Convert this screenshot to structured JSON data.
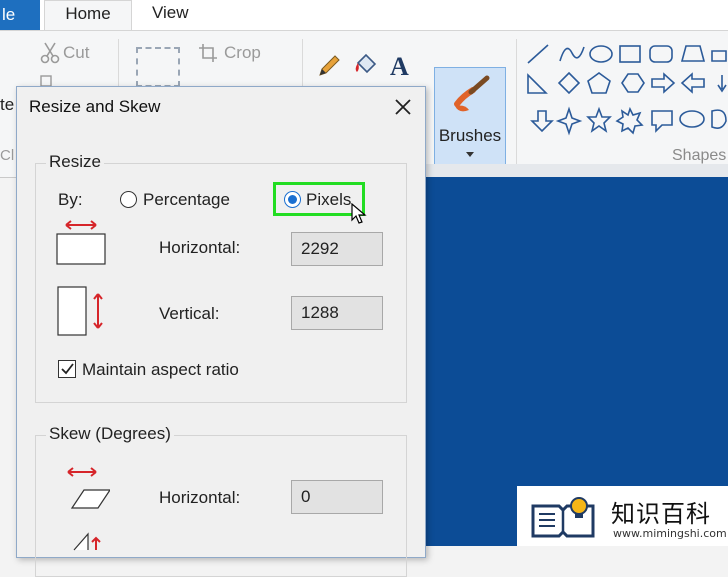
{
  "ribbon": {
    "tabs": [
      "le",
      "Home",
      "View"
    ],
    "clipboard_partial": "te",
    "cut_label": "Cut",
    "crop_label": "Crop",
    "clip_partial": "Cl",
    "brushes_label": "Brushes",
    "shapes_group_label": "Shapes"
  },
  "dialog": {
    "title": "Resize and Skew",
    "resize": {
      "legend": "Resize",
      "by_label": "By:",
      "percentage_label": "Percentage",
      "pixels_label": "Pixels",
      "selected": "Pixels",
      "horizontal_label": "Horizontal:",
      "horizontal_value": "2292",
      "vertical_label": "Vertical:",
      "vertical_value": "1288",
      "maintain_label": "Maintain aspect ratio",
      "maintain_checked": true
    },
    "skew": {
      "legend": "Skew (Degrees)",
      "horizontal_label": "Horizontal:",
      "horizontal_value": "0"
    }
  },
  "colors": {
    "accent": "#1e6fbf",
    "canvas": "#0c4c96",
    "highlight": "#22dd22",
    "arrow_red": "#d6252a"
  },
  "watermark": {
    "text": "知识百科",
    "url": "www.mimingshi.com"
  }
}
